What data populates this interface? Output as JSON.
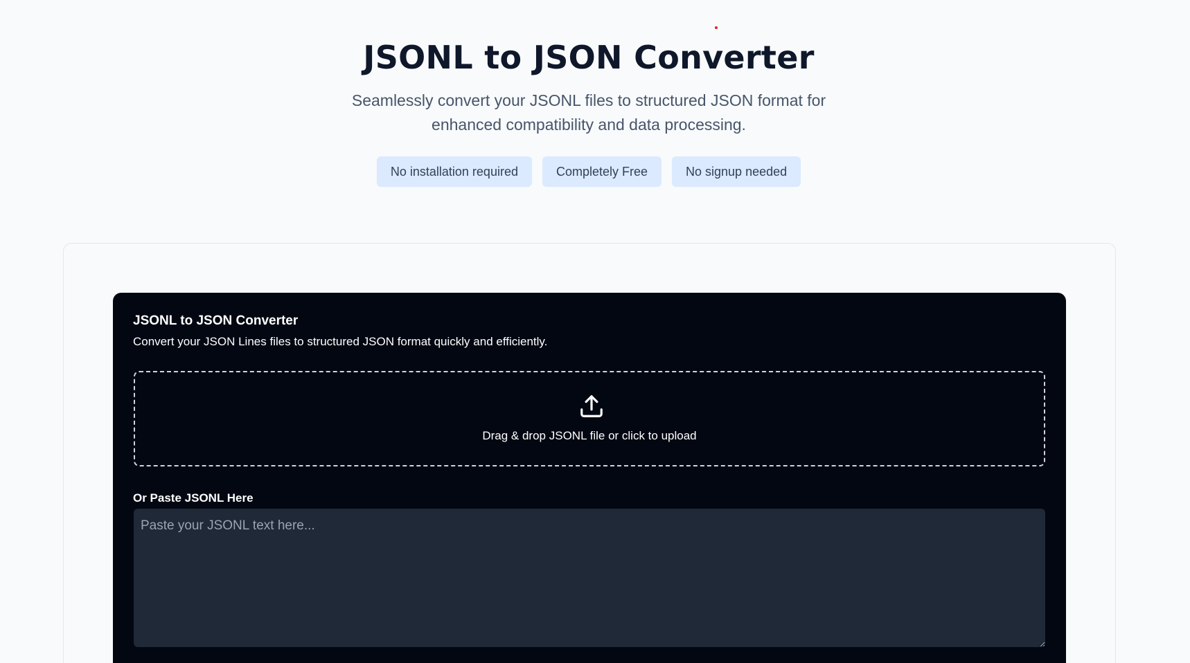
{
  "hero": {
    "title": "JSONL to JSON Converter",
    "subtitle": "Seamlessly convert your JSONL files to structured JSON format for enhanced compatibility and data processing.",
    "badges": [
      "No installation required",
      "Completely Free",
      "No signup needed"
    ]
  },
  "tool": {
    "title": "JSONL to JSON Converter",
    "description": "Convert your JSON Lines files to structured JSON format quickly and efficiently.",
    "dropzone_text": "Drag & drop JSONL file or click to upload",
    "upload_icon": "upload-icon",
    "paste_label": "Or Paste JSONL Here",
    "paste_placeholder": "Paste your JSONL text here...",
    "paste_value": ""
  },
  "colors": {
    "page_background": "#f8fafc",
    "badge_background": "#dbeafe",
    "tool_background": "#030712",
    "textarea_background": "#1f2937"
  }
}
